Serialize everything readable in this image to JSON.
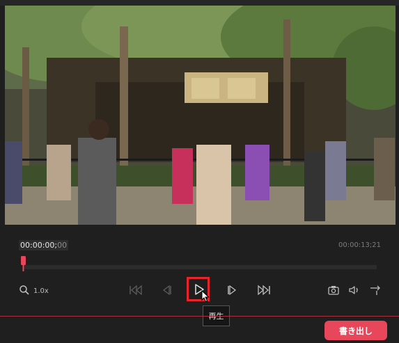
{
  "player": {
    "current_time_main": "00:00:00;",
    "current_time_frames": "00",
    "total_time": "00:00:13;21",
    "zoom_level": "1.0x",
    "progress": 0.0
  },
  "controls": {
    "zoom_icon": "magnifier-icon",
    "skip_start_icon": "skip-to-start-icon",
    "prev_frame_icon": "previous-frame-icon",
    "play_icon": "play-icon",
    "next_frame_icon": "next-frame-icon",
    "skip_end_icon": "skip-to-end-icon",
    "snapshot_icon": "camera-icon",
    "volume_icon": "speaker-icon",
    "export_frame_icon": "export-arrow-icon"
  },
  "tooltip": {
    "text": "再生"
  },
  "footer": {
    "export_label": "書き出し"
  },
  "colors": {
    "accent": "#e8465a",
    "highlight": "#e8242a",
    "background": "#1f1f1f"
  }
}
